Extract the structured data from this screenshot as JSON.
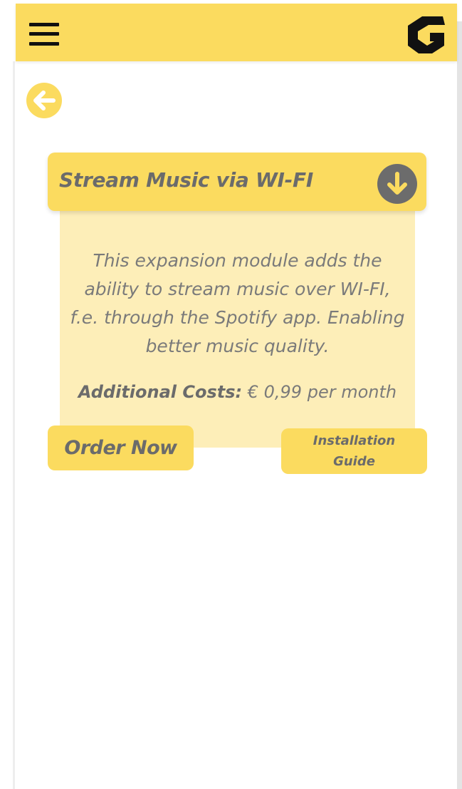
{
  "header": {
    "menu_icon": "hamburger-menu-icon",
    "logo_icon": "g-logo-icon",
    "accent_color": "#fbdb5f"
  },
  "navigation": {
    "back_icon": "arrow-left-circle-icon"
  },
  "module_card": {
    "title": "Stream Music via WI-FI",
    "expand_icon": "arrow-down-circle-icon",
    "description": "This expansion module adds the ability to stream music over WI-FI, f.e. through the Spotify app. Enabling better music quality.",
    "costs_label": "Additional Costs:",
    "costs_value": " € 0,99 per month",
    "header_color": "#fbdb5f",
    "body_color": "#fdeeb8",
    "text_color": "#6b6b6b"
  },
  "actions": {
    "order_label": "Order Now",
    "guide_label": "Installation Guide"
  }
}
